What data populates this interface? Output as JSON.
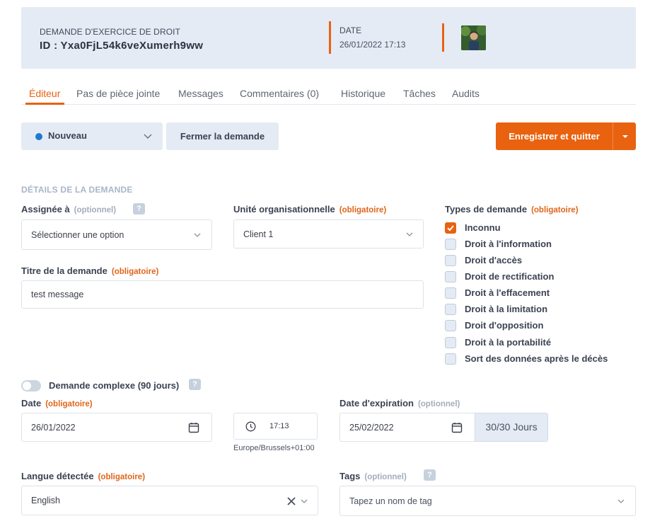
{
  "header": {
    "kind": "DEMANDE D'EXERCICE DE DROIT",
    "id": "ID : Yxa0FjL54k6veXumerh9ww",
    "date_label": "DATE",
    "date_value": "26/01/2022 17:13"
  },
  "tabs": [
    "Éditeur",
    "Pas de pièce jointe",
    "Messages",
    "Commentaires (0)",
    "Historique",
    "Tâches",
    "Audits"
  ],
  "toolbar": {
    "status": "Nouveau",
    "close_label": "Fermer la demande",
    "save_label": "Enregistrer et quitter"
  },
  "section_title": "DÉTAILS DE LA DEMANDE",
  "form": {
    "assignee": {
      "label": "Assignée à",
      "tag": "(optionnel)",
      "value": "Sélectionner une option"
    },
    "org_unit": {
      "label": "Unité organisationnelle",
      "tag": "(obligatoire)",
      "value": "Client 1"
    },
    "title": {
      "label": "Titre de la demande",
      "tag": "(obligatoire)",
      "value": "test message"
    },
    "types": {
      "label": "Types de demande",
      "tag": "(obligatoire)",
      "options": [
        {
          "label": "Inconnu",
          "checked": true
        },
        {
          "label": "Droit à l'information",
          "checked": false
        },
        {
          "label": "Droit d'accès",
          "checked": false
        },
        {
          "label": "Droit de rectification",
          "checked": false
        },
        {
          "label": "Droit à l'effacement",
          "checked": false
        },
        {
          "label": "Droit à la limitation",
          "checked": false
        },
        {
          "label": "Droit d'opposition",
          "checked": false
        },
        {
          "label": "Droit à la portabilité",
          "checked": false
        },
        {
          "label": "Sort des données après le décès",
          "checked": false
        }
      ]
    },
    "complex": {
      "label": "Demande complexe (90 jours)",
      "enabled": false
    },
    "date": {
      "label": "Date",
      "tag": "(obligatoire)",
      "value": "26/01/2022",
      "time": "17:13",
      "timezone": "Europe/Brussels+01:00"
    },
    "expiration": {
      "label": "Date d'expiration",
      "tag": "(optionnel)",
      "value": "25/02/2022",
      "days": "30/30 Jours"
    },
    "language": {
      "label": "Langue détectée",
      "tag": "(obligatoire)",
      "value": "English"
    },
    "tags": {
      "label": "Tags",
      "tag": "(optionnel)",
      "placeholder": "Tapez un nom de tag"
    }
  },
  "colors": {
    "accent": "#e8620f",
    "panel": "#e4ebf5",
    "status_dot": "#1f78d1"
  },
  "icons": [
    "chevron-down-icon",
    "calendar-icon",
    "clock-icon",
    "clear-icon",
    "help-icon",
    "check-icon"
  ]
}
